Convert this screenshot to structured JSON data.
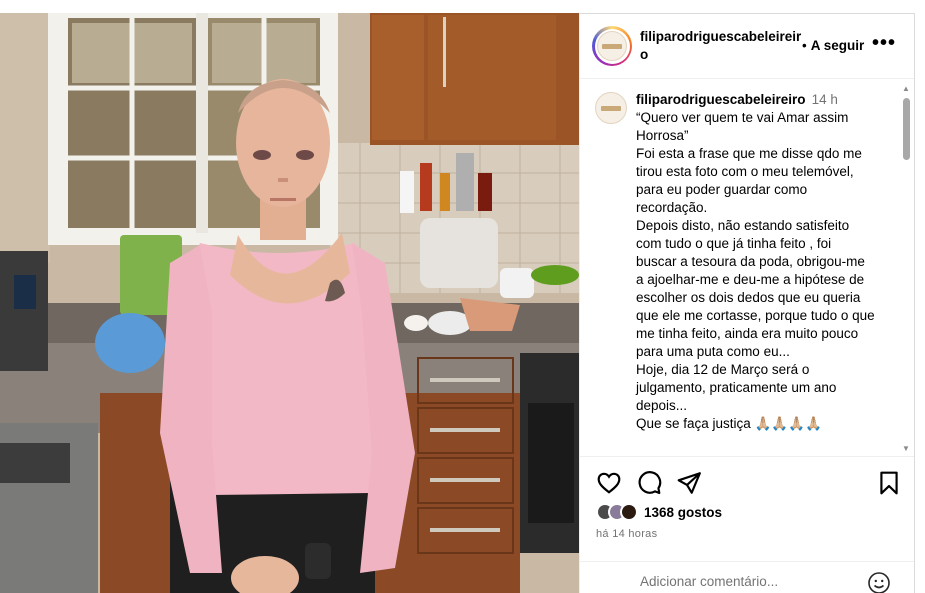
{
  "post": {
    "username": "filiparodriguescabeleireiro",
    "username_line1": "filiparodriguescabeleireir",
    "username_line2": "o",
    "follow_dot": "•",
    "follow_label": "A seguir",
    "more_label": "•••",
    "photo_alt": "Foto publicada"
  },
  "caption": {
    "username": "filiparodriguescabeleireiro",
    "time": "14 h",
    "lines": [
      "“Quero ver quem te vai Amar assim",
      "Horrosa”",
      "Foi esta a frase que me disse qdo me",
      "tirou esta foto com o meu telemóvel,",
      "para eu poder guardar como",
      "recordação.",
      "Depois disto, não estando satisfeito",
      "com tudo o que já tinha feito , foi",
      "buscar a tesoura da poda, obrigou-me",
      "a ajoelhar-me e deu-me a hipótese de",
      "escolher os dois dedos que eu queria",
      "que ele me cortasse, porque tudo o que",
      "me tinha feito, ainda era muito pouco",
      "para uma puta como eu...",
      "Hoje, dia 12 de Março será o",
      "julgamento, praticamente um ano",
      "depois...",
      "Que se faça justiça 🙏🏼🙏🏼🙏🏼🙏🏼"
    ]
  },
  "actions": {
    "icons": [
      "heart-icon",
      "comment-icon",
      "share-icon",
      "bookmark-icon"
    ],
    "likes_label": "1368 gostos",
    "time_ago": "há 14 horas"
  },
  "comment": {
    "placeholder": "Adicionar comentário..."
  },
  "colors": {
    "text": "#000000",
    "muted": "#737373",
    "border": "#dbdbdb",
    "shirt": "#f2b8c6",
    "cabinet": "#8b4a25"
  }
}
